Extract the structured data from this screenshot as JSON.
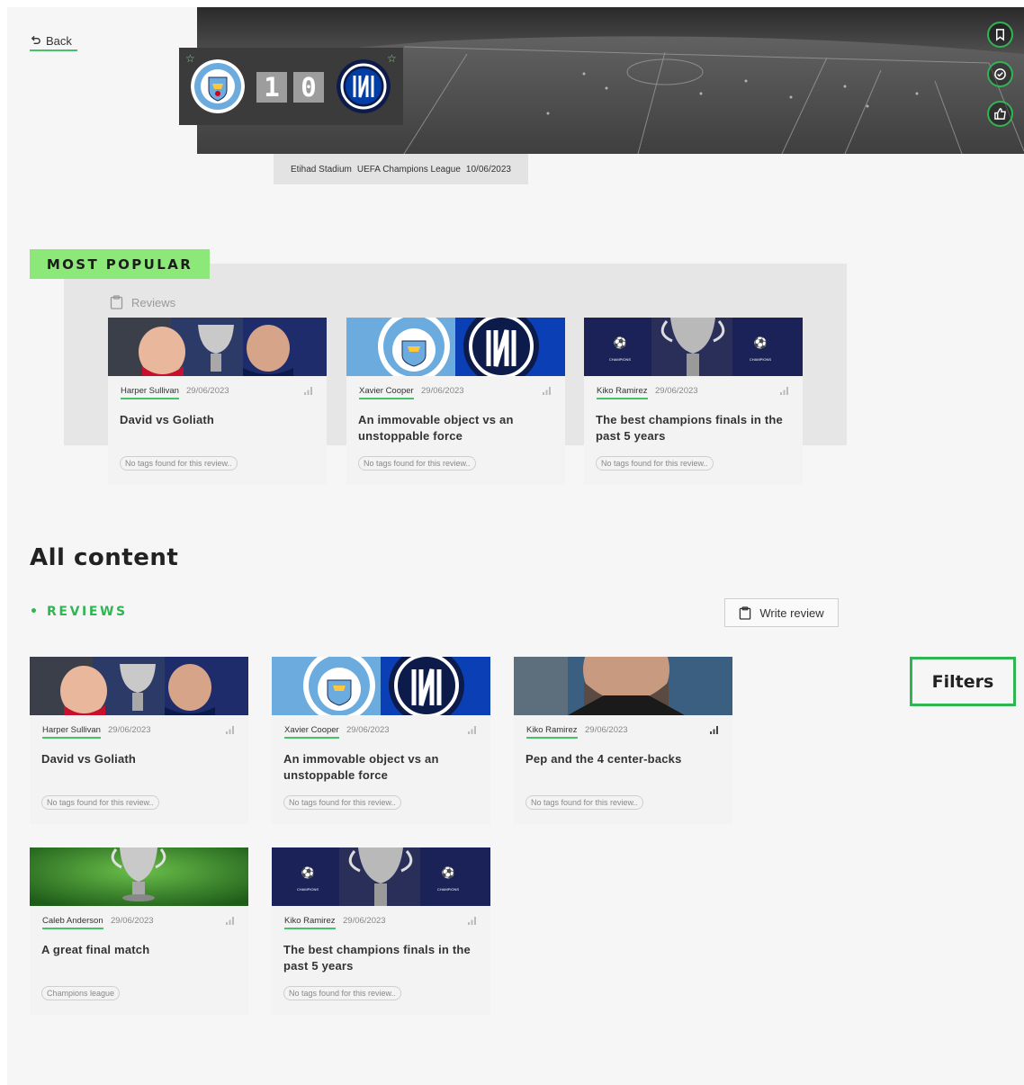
{
  "back": {
    "label": "Back"
  },
  "match": {
    "score_home": "1",
    "score_away": "0",
    "home_crest_icon": "manchester-city-crest",
    "away_crest_icon": "inter-crest",
    "stadium": "Etihad Stadium",
    "competition": "UEFA Champions League",
    "date": "10/06/2023"
  },
  "actions": [
    "bookmark-icon",
    "check-circle-icon",
    "thumbs-up-icon"
  ],
  "most_popular": {
    "badge": "MOST POPULAR",
    "section_label": "Reviews",
    "cards": [
      {
        "author": "Harper Sullivan",
        "date": "29/06/2023",
        "title": "David vs Goliath",
        "tag": "No tags found for this review..",
        "image": "players-trophy"
      },
      {
        "author": "Xavier Cooper",
        "date": "29/06/2023",
        "title": "An immovable object vs an unstoppable force",
        "tag": "No tags found for this review..",
        "image": "club-crests"
      },
      {
        "author": "Kiko Ramirez",
        "date": "29/06/2023",
        "title": "The best champions finals in the past 5 years",
        "tag": "No tags found for this review..",
        "image": "ucl-trophy-blue"
      }
    ]
  },
  "all_content": {
    "title": "All content",
    "reviews_heading": "REVIEWS",
    "write_review": "Write review",
    "filters": "Filters",
    "cards": [
      {
        "author": "Harper Sullivan",
        "date": "29/06/2023",
        "title": "David vs Goliath",
        "tag": "No tags found for this review..",
        "image": "players-trophy"
      },
      {
        "author": "Xavier Cooper",
        "date": "29/06/2023",
        "title": "An immovable object vs an unstoppable force",
        "tag": "No tags found for this review..",
        "image": "club-crests"
      },
      {
        "author": "Kiko Ramirez",
        "date": "29/06/2023",
        "title": "Pep and the 4 center-backs",
        "tag": "No tags found for this review..",
        "image": "coach-portrait"
      },
      {
        "author": "Caleb Anderson",
        "date": "29/06/2023",
        "title": "A great final match",
        "tag": "Champions league",
        "image": "trophy-on-grass"
      },
      {
        "author": "Kiko Ramirez",
        "date": "29/06/2023",
        "title": "The best champions finals in the past 5 years",
        "tag": "No tags found for this review..",
        "image": "ucl-trophy-blue"
      }
    ]
  },
  "colors": {
    "accent": "#2fb552",
    "badge": "#8ce879",
    "page": "#f7f6f6",
    "card": "#f3f3f3"
  }
}
